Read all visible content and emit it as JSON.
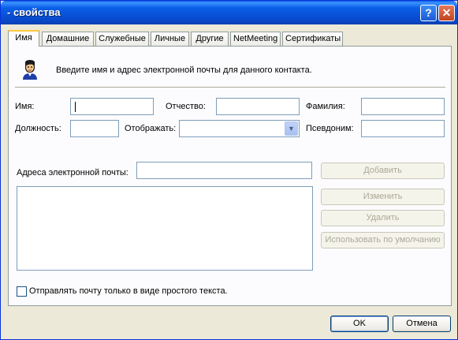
{
  "window": {
    "title": "- свойства",
    "help_glyph": "?",
    "close_glyph": "✕"
  },
  "tabs": [
    {
      "label": "Имя"
    },
    {
      "label": "Домашние"
    },
    {
      "label": "Служебные"
    },
    {
      "label": "Личные"
    },
    {
      "label": "Другие"
    },
    {
      "label": "NetMeeting"
    },
    {
      "label": "Сертификаты"
    }
  ],
  "intro": {
    "text": "Введите имя и адрес электронной почты для данного контакта.",
    "icon": "contact-person-icon"
  },
  "fields": {
    "first_name_label": "Имя:",
    "first_name_value": "",
    "middle_name_label": "Отчество:",
    "middle_name_value": "",
    "last_name_label": "Фамилия:",
    "last_name_value": "",
    "title_label": "Должность:",
    "title_value": "",
    "display_label": "Отображать:",
    "display_value": "",
    "nickname_label": "Псевдоним:",
    "nickname_value": "",
    "email_label": "Адреса электронной почты:",
    "email_value": ""
  },
  "email_buttons": {
    "add": "Добавить",
    "edit": "Изменить",
    "remove": "Удалить",
    "set_default": "Использовать по умолчанию"
  },
  "plain_text_checkbox": {
    "label": "Отправлять почту только в виде простого текста.",
    "checked": false
  },
  "footer": {
    "ok": "OK",
    "cancel": "Отмена"
  },
  "colors": {
    "title_bar": "#0A5FE8",
    "dialog_bg": "#ECE9D8",
    "active_tab_accent": "#FFC83C"
  }
}
